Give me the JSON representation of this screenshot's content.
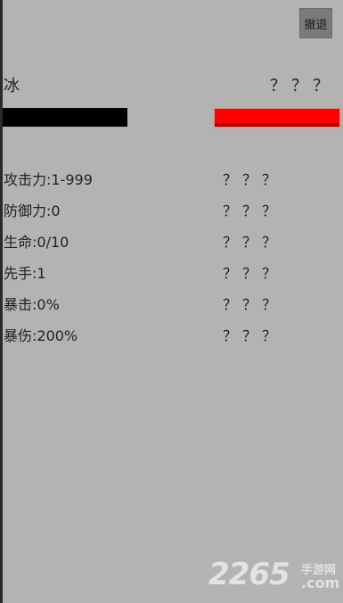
{
  "header": {
    "retreat_label": "撤退"
  },
  "player": {
    "name": "冰",
    "hp_fraction": 1.0,
    "hp_color": "#000000"
  },
  "enemy": {
    "name": "？？？",
    "hp_fraction": 1.0,
    "hp_color": "#ff0000"
  },
  "stats": [
    {
      "label": "攻击力:1-999",
      "enemy_value": "？？？"
    },
    {
      "label": "防御力:0",
      "enemy_value": "？？？"
    },
    {
      "label": "生命:0/10",
      "enemy_value": "？？？"
    },
    {
      "label": "先手:1",
      "enemy_value": "？？？"
    },
    {
      "label": "暴击:0%",
      "enemy_value": "？？？"
    },
    {
      "label": "暴伤:200%",
      "enemy_value": "？？？"
    }
  ],
  "watermark": {
    "number": "2265",
    "site_cn": "手游网",
    "domain": ".com"
  }
}
